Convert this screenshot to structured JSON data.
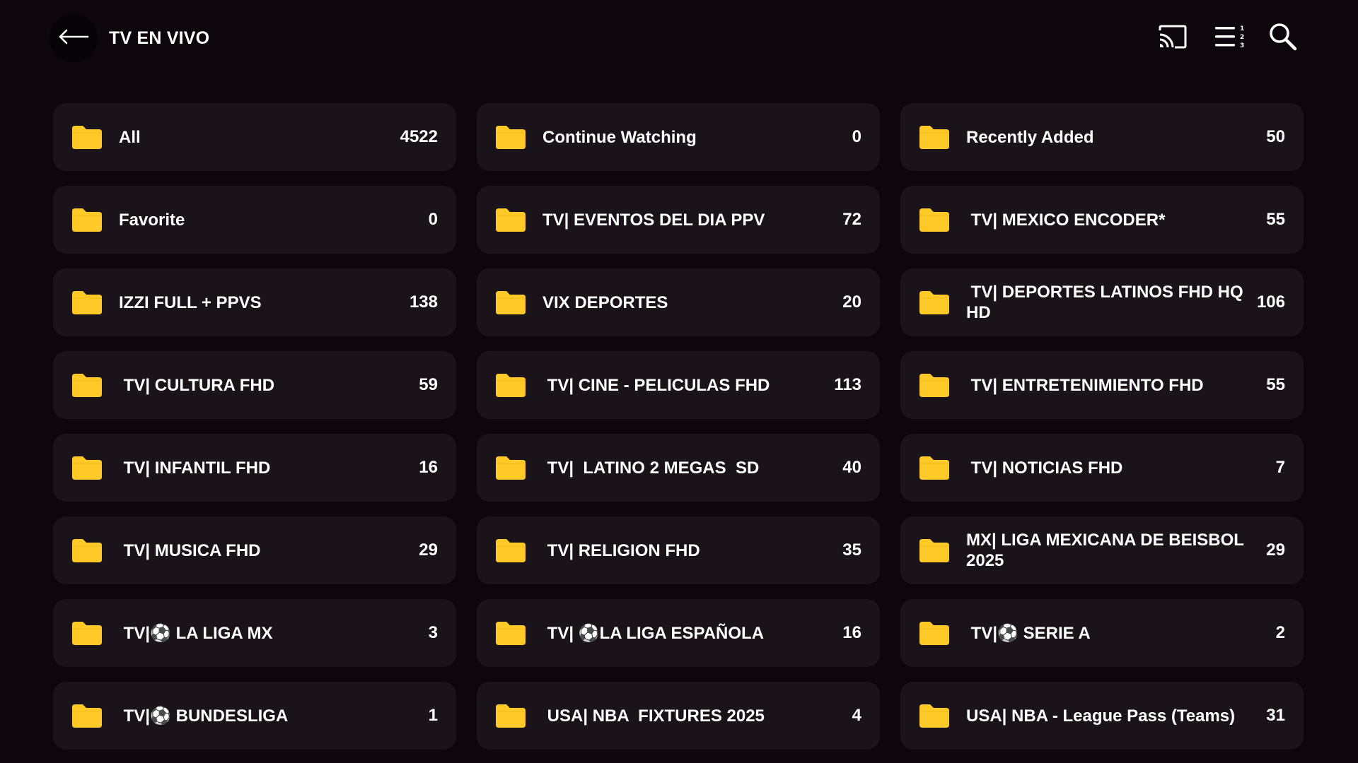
{
  "header": {
    "title": "TV EN VIVO",
    "icons": [
      "back-arrow-icon",
      "cast-icon",
      "sort-numbered-list-icon",
      "search-icon"
    ]
  },
  "colors": {
    "background": "#0d070d",
    "card": "#1a131a",
    "folder": "#ffc928",
    "text": "#ffffff"
  },
  "categories": [
    {
      "label": "All",
      "count": "4522"
    },
    {
      "label": "Continue Watching",
      "count": "0"
    },
    {
      "label": "Recently Added",
      "count": "50"
    },
    {
      "label": "Favorite",
      "count": "0"
    },
    {
      "label": "TV| EVENTOS DEL DIA PPV",
      "count": "72"
    },
    {
      "label": " TV| MEXICO ENCODER*",
      "count": "55"
    },
    {
      "label": "IZZI FULL + PPVS",
      "count": "138"
    },
    {
      "label": "VIX DEPORTES",
      "count": "20"
    },
    {
      "label": " TV| DEPORTES LATINOS FHD HQ HD",
      "count": "106"
    },
    {
      "label": " TV| CULTURA FHD",
      "count": "59"
    },
    {
      "label": " TV| CINE - PELICULAS FHD",
      "count": "113"
    },
    {
      "label": " TV| ENTRETENIMIENTO FHD",
      "count": "55"
    },
    {
      "label": " TV| INFANTIL FHD",
      "count": "16"
    },
    {
      "label": " TV|  LATINO 2 MEGAS  SD",
      "count": "40"
    },
    {
      "label": " TV| NOTICIAS FHD",
      "count": "7"
    },
    {
      "label": " TV| MUSICA FHD",
      "count": "29"
    },
    {
      "label": " TV| RELIGION FHD",
      "count": "35"
    },
    {
      "label": "MX| LIGA MEXICANA DE BEISBOL 2025",
      "count": "29"
    },
    {
      "label": " TV|⚽ LA LIGA MX",
      "count": "3"
    },
    {
      "label": " TV| ⚽LA LIGA ESPAÑOLA",
      "count": "16"
    },
    {
      "label": " TV|⚽ SERIE A",
      "count": "2"
    },
    {
      "label": " TV|⚽ BUNDESLIGA",
      "count": "1"
    },
    {
      "label": " USA| NBA  FIXTURES 2025",
      "count": "4"
    },
    {
      "label": "USA| NBA - League Pass (Teams)",
      "count": "31"
    }
  ]
}
